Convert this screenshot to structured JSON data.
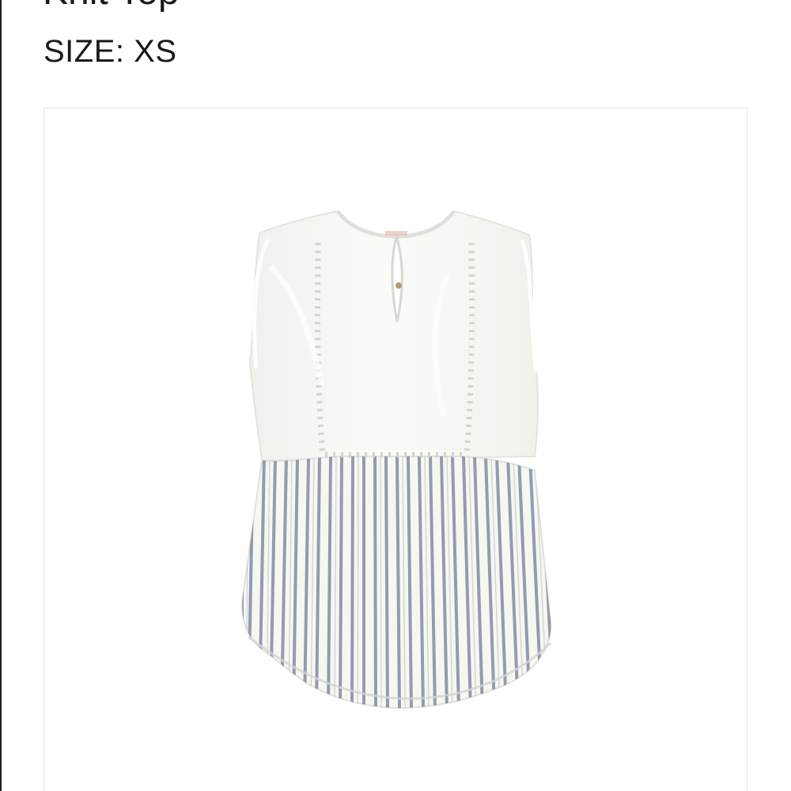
{
  "product": {
    "title": "Knit Top",
    "size_label": "SIZE:",
    "size_value": "XS"
  },
  "image": {
    "subject": "sleeveless-striped-top",
    "colors": {
      "body": "#f8f8f5",
      "shadow": "#e9e9e4",
      "stripe": "#6d7893",
      "trim": "#c9ccc9",
      "card_border": "#e7e7e7"
    }
  }
}
